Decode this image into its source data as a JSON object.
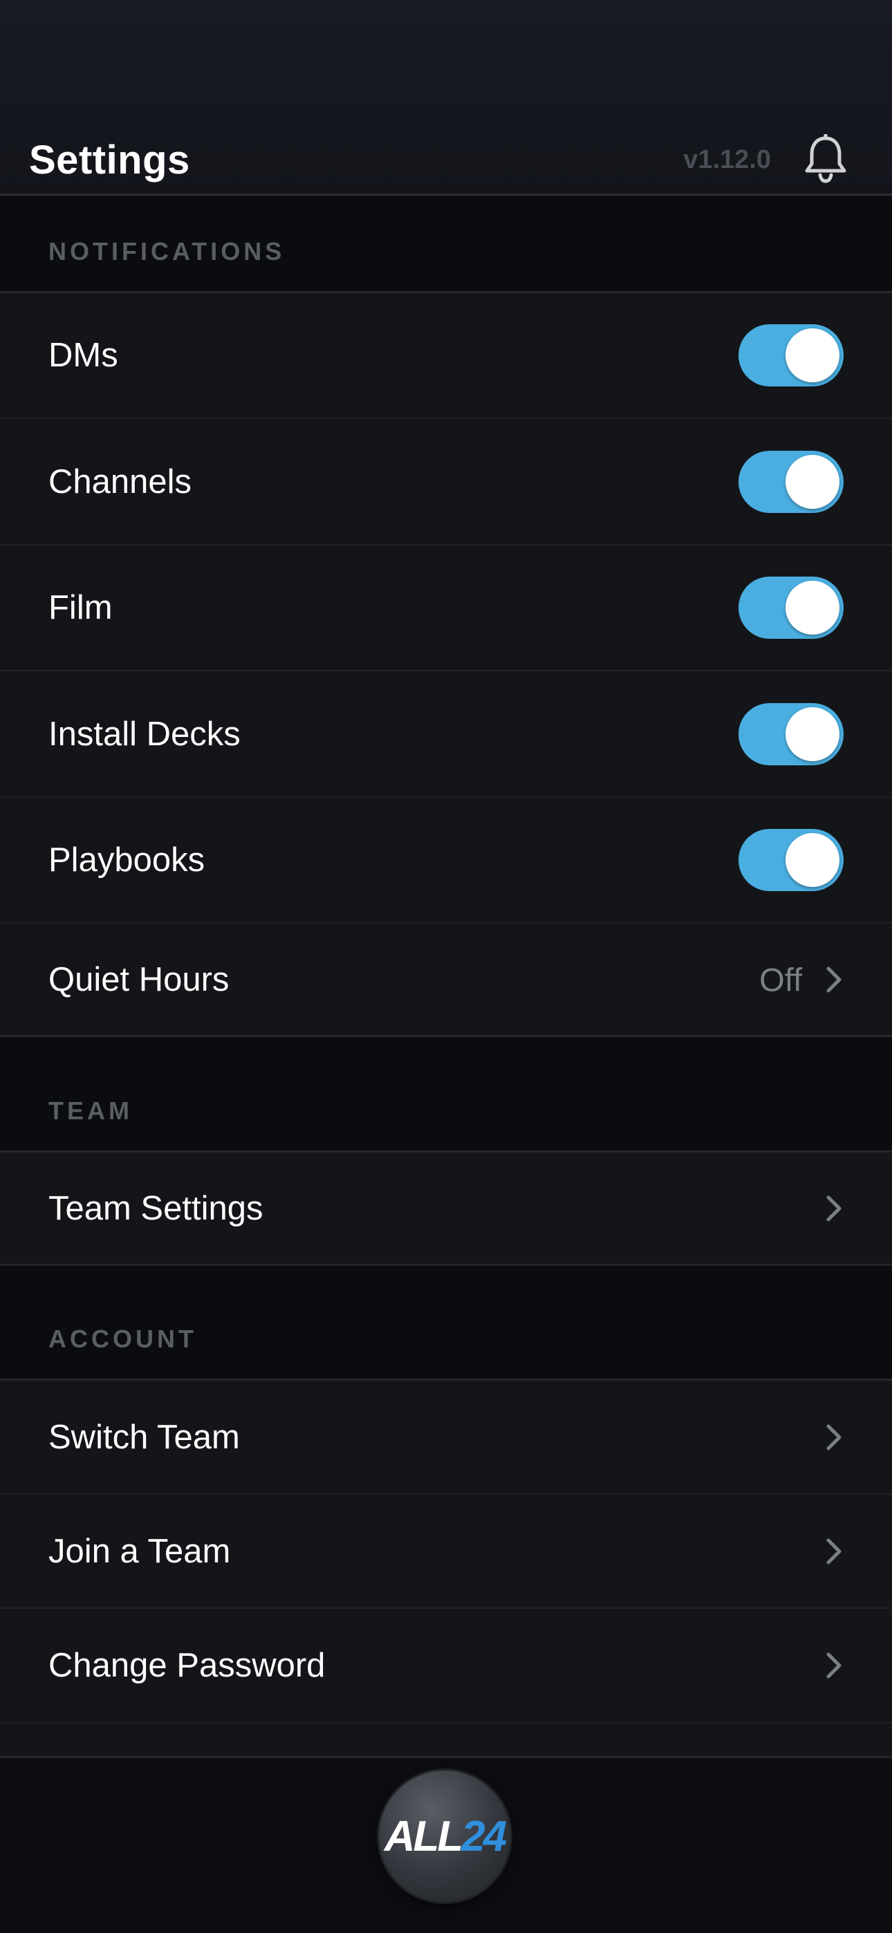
{
  "header": {
    "title": "Settings",
    "version": "v1.12.0",
    "notification_icon": "bell-icon"
  },
  "sections": {
    "notifications": {
      "label": "NOTIFICATIONS",
      "items": [
        {
          "label": "DMs",
          "toggle": true
        },
        {
          "label": "Channels",
          "toggle": true
        },
        {
          "label": "Film",
          "toggle": true
        },
        {
          "label": "Install Decks",
          "toggle": true
        },
        {
          "label": "Playbooks",
          "toggle": true
        }
      ],
      "quiet_hours": {
        "label": "Quiet Hours",
        "value": "Off"
      }
    },
    "team": {
      "label": "TEAM",
      "items": [
        {
          "label": "Team Settings"
        }
      ]
    },
    "account": {
      "label": "ACCOUNT",
      "items": [
        {
          "label": "Switch Team"
        },
        {
          "label": "Join a Team"
        },
        {
          "label": "Change Password"
        }
      ]
    }
  },
  "footer": {
    "logo_text_part1": "ALL",
    "logo_text_part2": "24"
  },
  "colors": {
    "toggle_on": "#4aaee0",
    "background": "#0b0c0f",
    "row": "#141519"
  }
}
